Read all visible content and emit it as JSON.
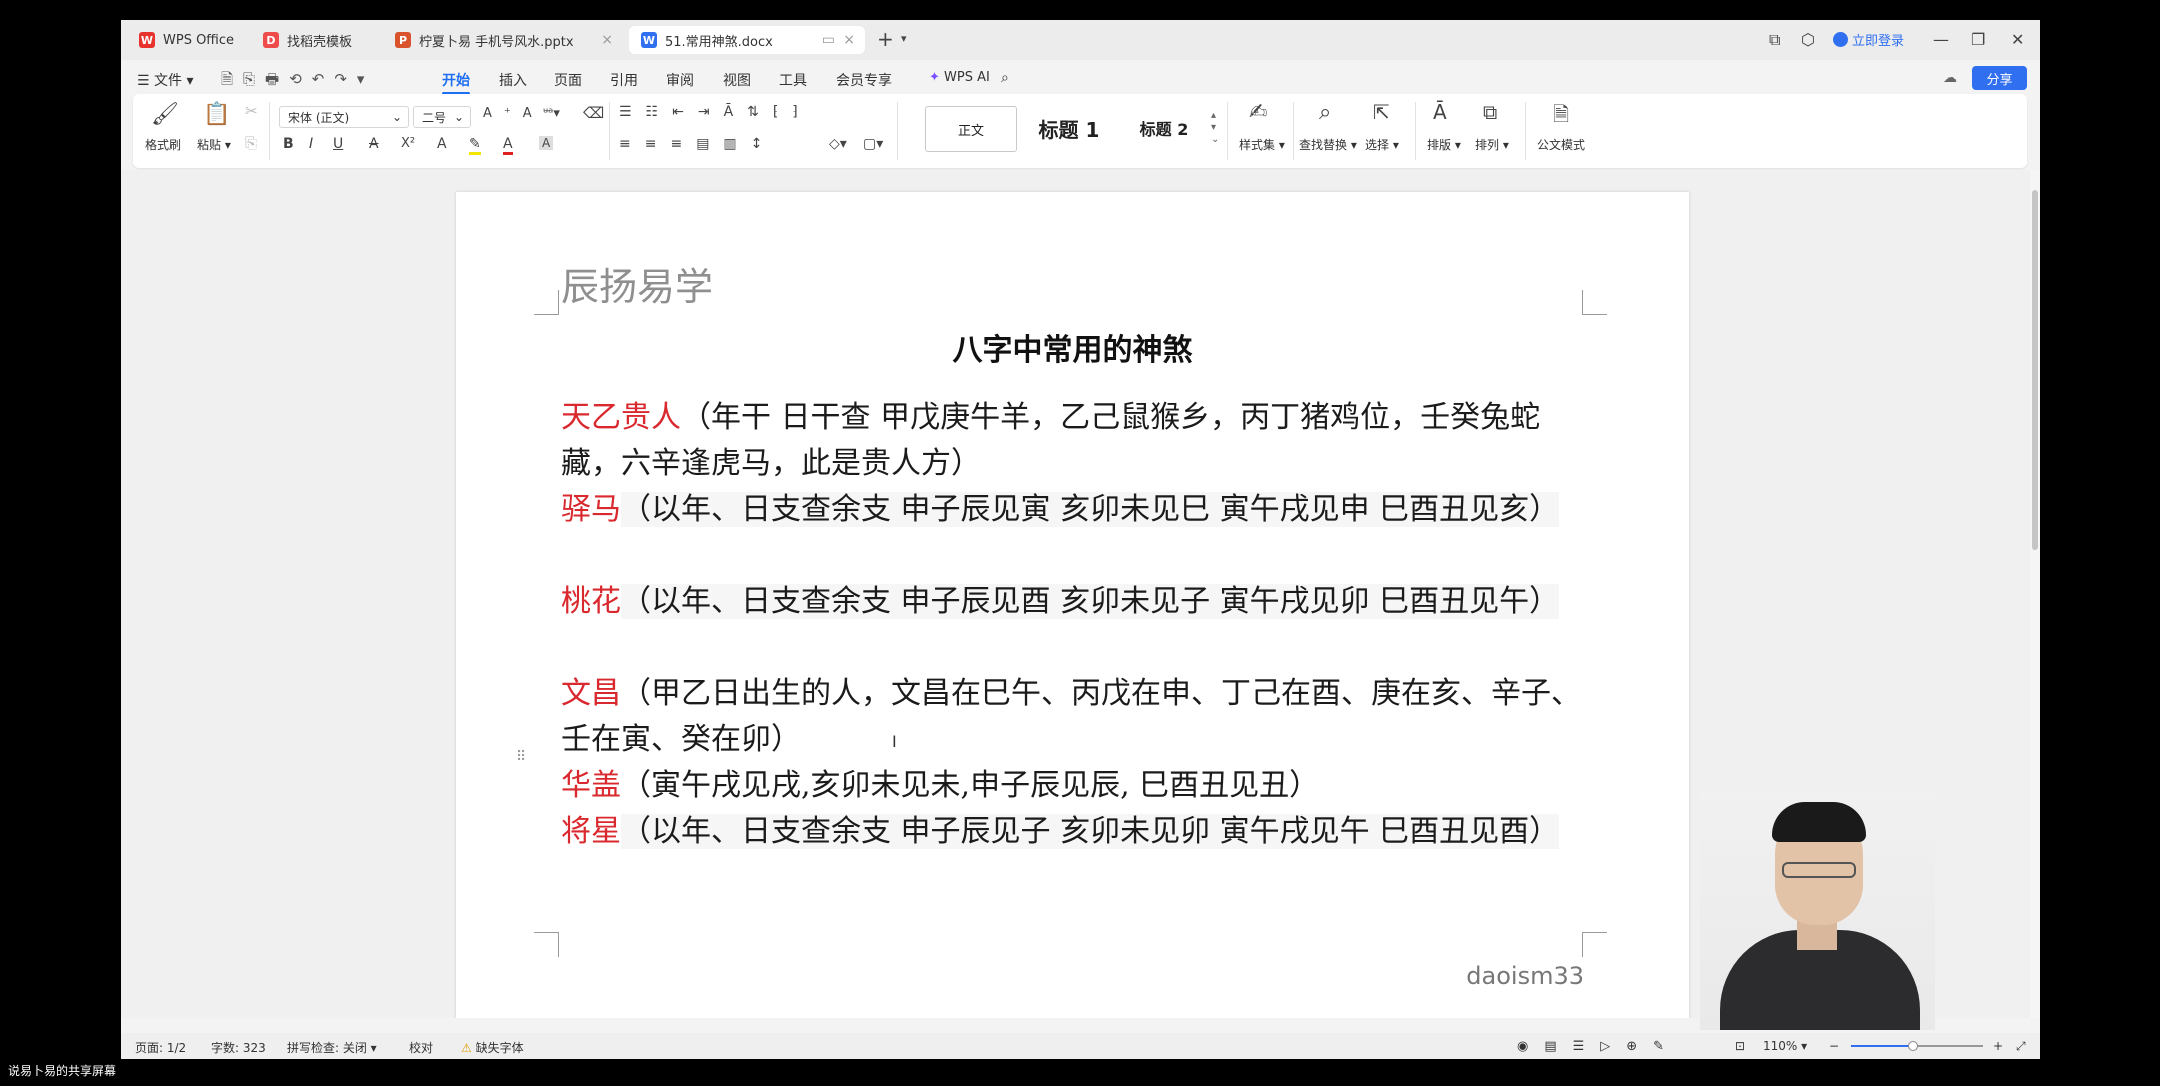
{
  "tabs": [
    {
      "label": "WPS Office",
      "icon": "W"
    },
    {
      "label": "找稻壳模板",
      "icon": "D"
    },
    {
      "label": "柠夏卜易 手机号风水.pptx",
      "icon": "P"
    },
    {
      "label": "51.常用神煞.docx",
      "icon": "W"
    }
  ],
  "window": {
    "login": "立即登录",
    "share": "分享"
  },
  "menu": {
    "file": "文件",
    "items": [
      "开始",
      "插入",
      "页面",
      "引用",
      "审阅",
      "视图",
      "工具",
      "会员专享"
    ],
    "wps_ai": "WPS AI"
  },
  "ribbon": {
    "format_painter": "格式刷",
    "paste": "粘贴",
    "font_name": "宋体 (正文)",
    "font_size": "二号",
    "style_normal": "正文",
    "style_h1": "标题 1",
    "style_h2": "标题 2",
    "style_set": "样式集",
    "find_replace": "查找替换",
    "select": "选择",
    "layout": "排版",
    "arrange": "排列",
    "official_mode": "公文模式"
  },
  "document": {
    "header": "辰扬易学",
    "title": "八字中常用的神煞",
    "paragraphs": [
      {
        "name": "天乙贵人",
        "text": "（年干  日干查  甲戊庚牛羊，乙己鼠猴乡，丙丁猪鸡位，壬癸兔蛇藏，六辛逢虎马，此是贵人方）"
      },
      {
        "name": "驿马",
        "text": "（以年、日支查余支  申子辰见寅  亥卯未见巳  寅午戌见申  巳酉丑见亥）"
      },
      {
        "name": "桃花",
        "text": "（以年、日支查余支  申子辰见酉  亥卯未见子  寅午戌见卯  巳酉丑见午）"
      },
      {
        "name": "文昌",
        "text": "（甲乙日出生的人，文昌在巳午、丙戊在申、丁己在酉、庚在亥、辛子、壬在寅、癸在卯）"
      },
      {
        "name": "华盖",
        "text": "（寅午戌见戌,亥卯未见未,申子辰见辰, 巳酉丑见丑）"
      },
      {
        "name": "将星",
        "text": "（以年、日支查余支  申子辰见子  亥卯未见卯  寅午戌见午  巳酉丑见酉）"
      }
    ],
    "footer": "daoism33"
  },
  "status": {
    "page": "页面: 1/2",
    "words": "字数: 323",
    "spell": "拼写检查: 关闭",
    "proof": "校对",
    "missing_font": "缺失字体",
    "zoom": "110%"
  },
  "caption": "说易卜易的共享屏幕"
}
